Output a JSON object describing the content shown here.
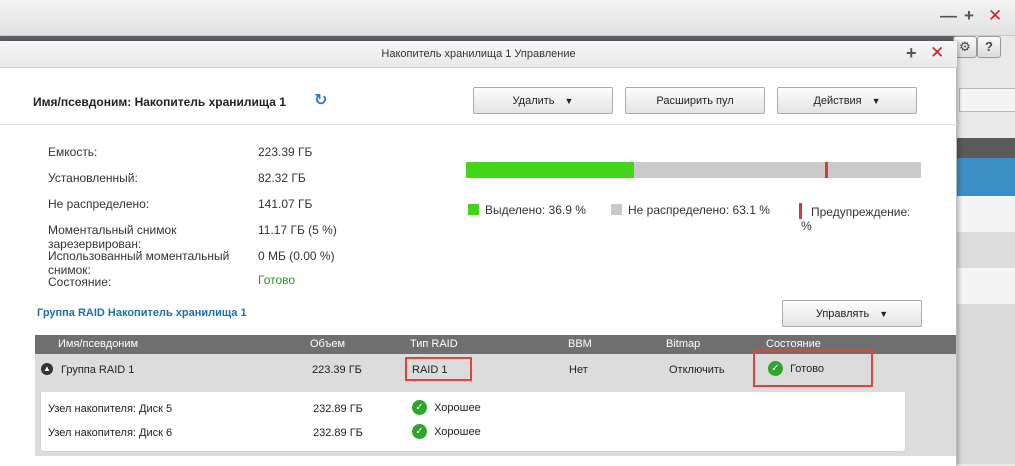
{
  "background": {
    "controls": [
      "—",
      "+",
      "✕"
    ],
    "right_buttons": [
      "⚙",
      "?"
    ]
  },
  "dialog": {
    "title": "Накопитель хранилища 1 Управление",
    "title_plus": "+",
    "title_close": "✕"
  },
  "header": {
    "pool_name": "Имя/псевдоним: Накопитель хранилища 1",
    "buttons": {
      "delete": "Удалить",
      "expand_pool": "Расширить пул",
      "actions": "Действия"
    }
  },
  "info": {
    "rows": [
      {
        "label": "Емкость:",
        "value": "223.39 ГБ"
      },
      {
        "label": "Установленный:",
        "value": "82.32 ГБ"
      },
      {
        "label": "Не распределено:",
        "value": "141.07 ГБ"
      },
      {
        "label": "Моментальный снимок зарезервирован:",
        "value": "11.17 ГБ (5 %)"
      },
      {
        "label": "Использованный моментальный снимок:",
        "value": "0 МБ (0.00 %)"
      },
      {
        "label": "Состояние:",
        "value": "Готово"
      }
    ]
  },
  "usage": {
    "allocated_percent": 36.9,
    "unallocated_percent": 63.1,
    "warning_percent": 79,
    "allocated_color": "#43d41b",
    "unallocated_color": "#c9c9c9",
    "warning_color": "#d23a3a",
    "legend": {
      "allocated": "Выделено: 36.9 %",
      "unallocated": "Не распределено: 63.1 %",
      "warning": "Предупреждение:",
      "warning_suffix": "%"
    }
  },
  "raid": {
    "section_title": "Группа RAID Накопитель хранилища 1",
    "manage_button": "Управлять",
    "columns": [
      "Имя/псевдоним",
      "Объем",
      "Тип RAID",
      "BBM",
      "Bitmap",
      "Состояние"
    ],
    "group": {
      "name": "Группа RAID 1",
      "size": "223.39 ГБ",
      "raid_type": "RAID 1",
      "bbm": "Нет",
      "bitmap": "Отключить",
      "status": "Готово"
    },
    "disks": [
      {
        "name": "Узел накопителя: Диск 5",
        "size": "232.89 ГБ",
        "status": "Хорошее"
      },
      {
        "name": "Узел накопителя: Диск 6",
        "size": "232.89 ГБ",
        "status": "Хорошее"
      }
    ]
  }
}
